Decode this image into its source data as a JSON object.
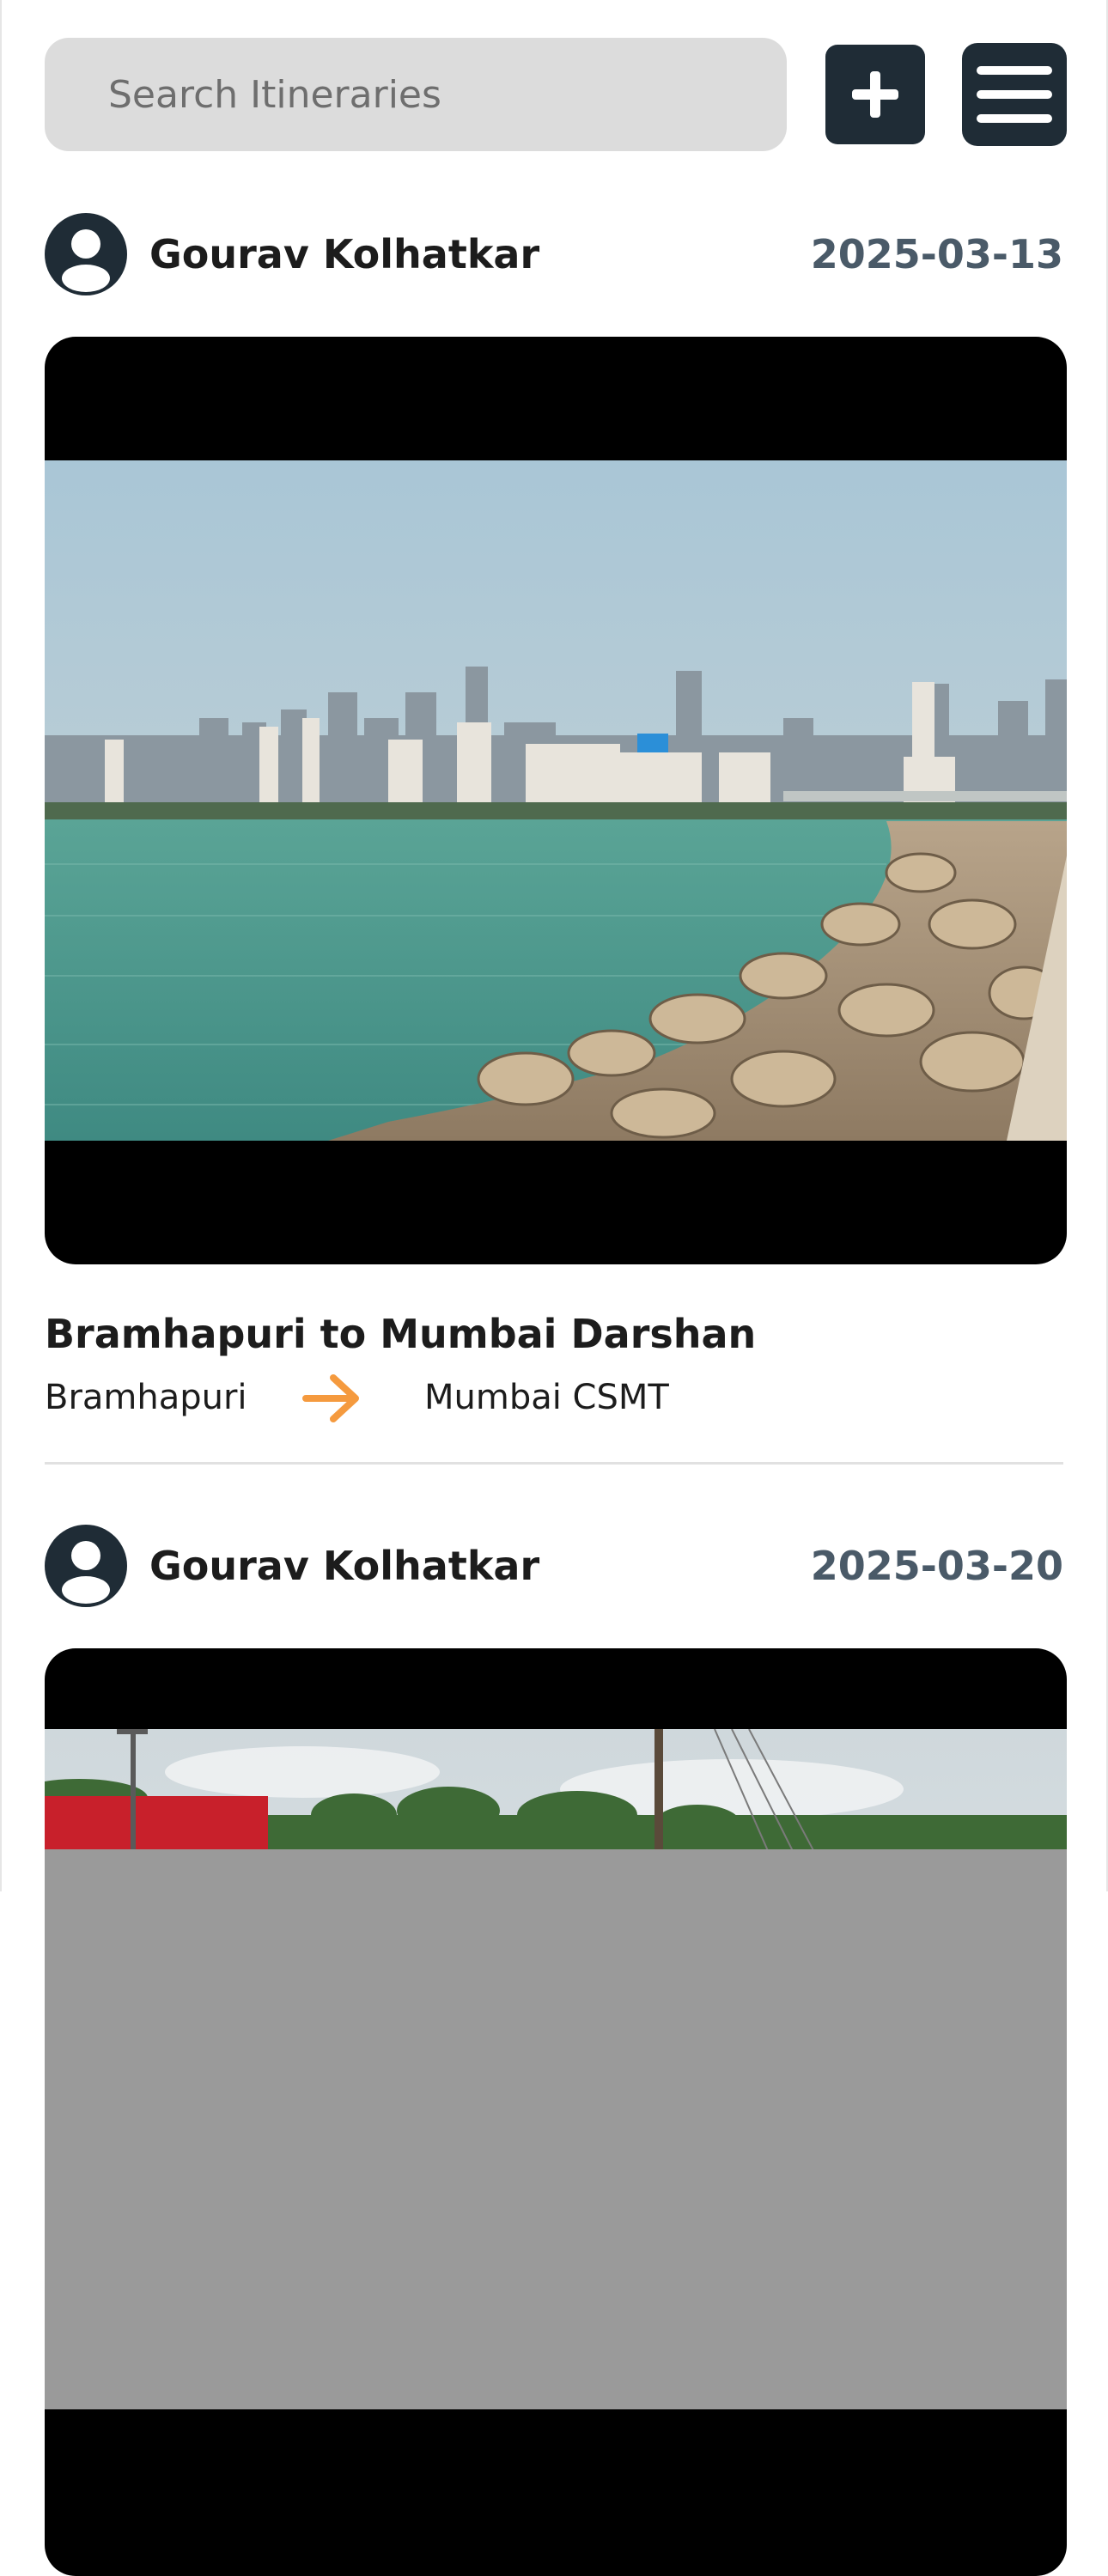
{
  "search": {
    "placeholder": "Search Itineraries"
  },
  "toolbar": {
    "add_icon": "plus-icon",
    "menu_icon": "hamburger-menu-icon"
  },
  "colors": {
    "dark": "#1f2c36",
    "accent_arrow": "#f59a3e",
    "date_text": "#4a5a68",
    "search_bg": "#dcdcdc"
  },
  "posts": [
    {
      "author": "Gourav Kolhatkar",
      "date": "2025-03-13",
      "title": "Bramhapuri to Mumbai Darshan",
      "from": "Bramhapuri",
      "to": "Mumbai CSMT",
      "avatar_icon": "user-avatar-icon",
      "arrow_icon": "arrow-right-icon"
    },
    {
      "author": "Gourav Kolhatkar",
      "date": "2025-03-20",
      "avatar_icon": "user-avatar-icon"
    }
  ]
}
